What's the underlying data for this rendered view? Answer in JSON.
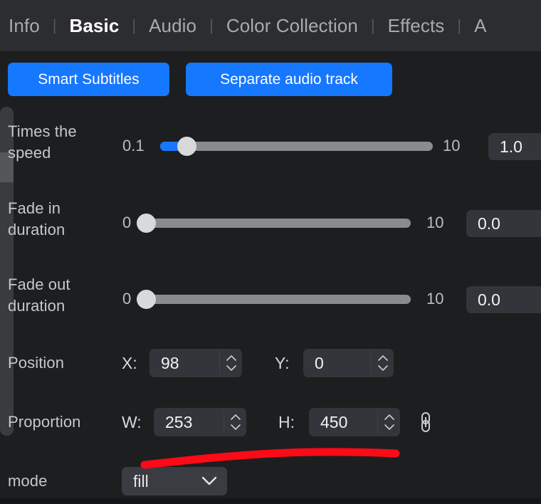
{
  "tabs": [
    {
      "label": "Info",
      "active": false
    },
    {
      "label": "Basic",
      "active": true
    },
    {
      "label": "Audio",
      "active": false
    },
    {
      "label": "Color Collection",
      "active": false
    },
    {
      "label": "Effects",
      "active": false
    },
    {
      "label": "A",
      "active": false
    }
  ],
  "separator": "|",
  "actions": {
    "smart_subtitles": "Smart Subtitles",
    "separate_audio_track": "Separate audio track"
  },
  "rows": {
    "speed": {
      "label": "Times the speed",
      "min": "0.1",
      "max": "10",
      "value": "1.0",
      "fill_percent": 8
    },
    "fade_in": {
      "label": "Fade in duration",
      "min": "0",
      "max": "10",
      "value": "0.0",
      "fill_percent": 0
    },
    "fade_out": {
      "label": "Fade out duration",
      "min": "0",
      "max": "10",
      "value": "0.0",
      "fill_percent": 0
    },
    "position": {
      "label": "Position",
      "x_label": "X:",
      "x_value": "98",
      "y_label": "Y:",
      "y_value": "0"
    },
    "proportion": {
      "label": "Proportion",
      "w_label": "W:",
      "w_value": "253",
      "h_label": "H:",
      "h_value": "450",
      "link_icon": "chain-link-icon"
    },
    "mode": {
      "label": "mode",
      "value": "fill",
      "chevron_icon": "chevron-down-icon"
    }
  },
  "scrollbar": {
    "name": "vertical-scrollbar"
  },
  "annotation": {
    "type": "freehand-underline",
    "color": "#fb0a17"
  },
  "colors": {
    "accent_blue": "#1677ff",
    "header_bg": "#2c2d31",
    "body_bg": "#1d1e20",
    "field_bg": "#34353a",
    "track_gray": "#8a8b8d",
    "thumb_gray": "#d8d9db",
    "text_primary": "#f2f3f4",
    "text_secondary": "#bdbec0",
    "annotation_red": "#fb0a17"
  }
}
